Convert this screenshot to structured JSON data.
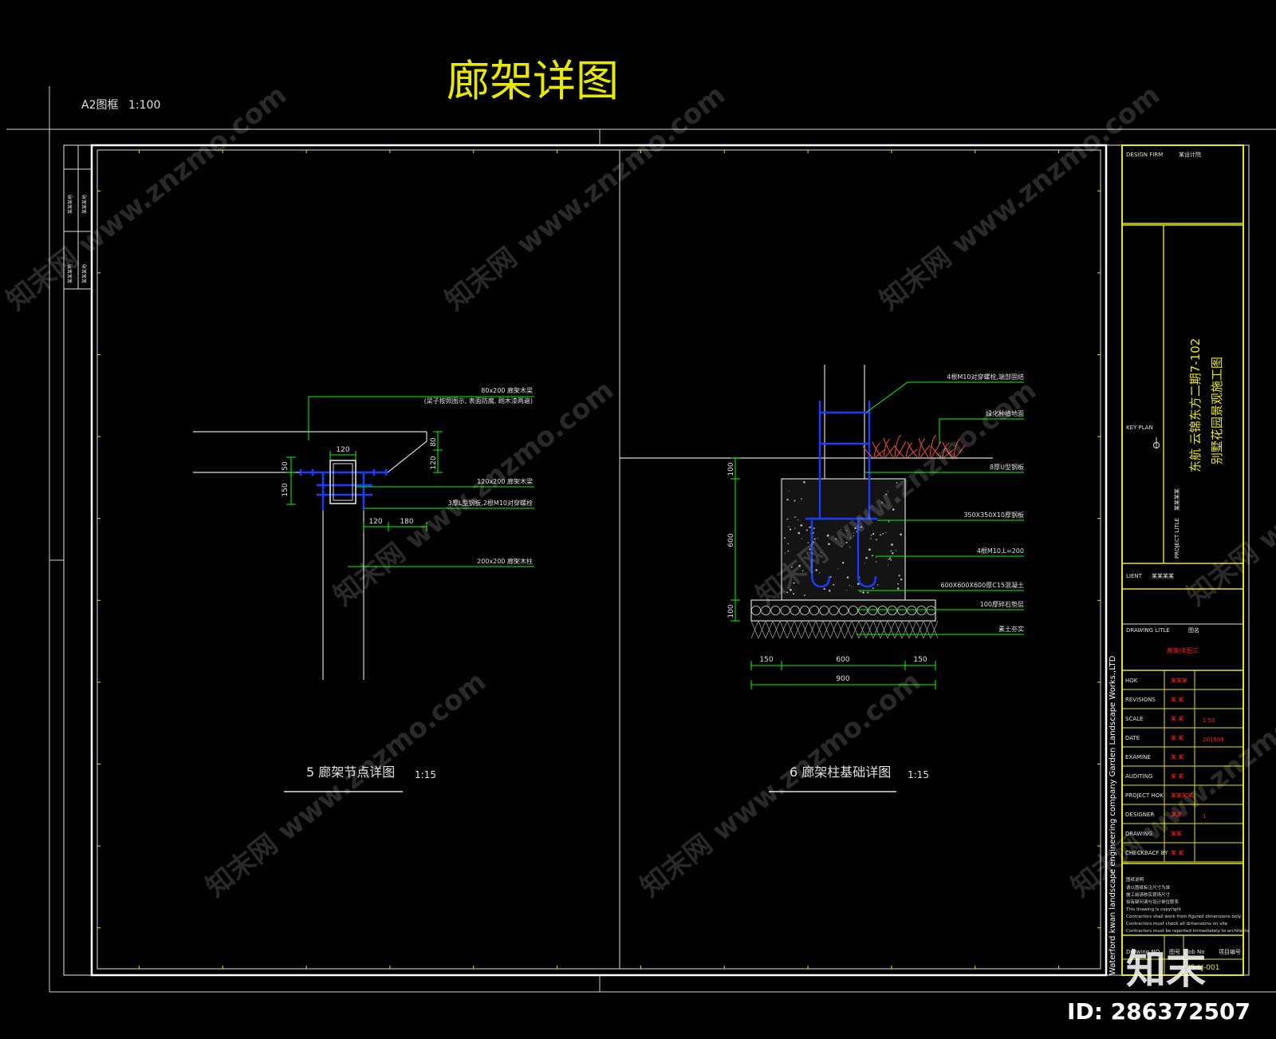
{
  "sheet": {
    "title": "廊架详图",
    "frame_label": "A2图框",
    "frame_scale": "1:100",
    "vertical_credit": "Waterford kwan landscape engineering company Garden Landscape Works.,LTD"
  },
  "left_margin_labels": [
    "某某某地",
    "某某某地",
    "某某某地",
    "某某某地"
  ],
  "detail5": {
    "title": "5 廊架节点详图",
    "scale": "1:15",
    "annotations": [
      "80x200 廊架木梁",
      "(梁子按照图示, 表面防腐, 刷木漆两遍)",
      "120x200 廊架木梁",
      "3厚L型钢板,2根M10对穿螺栓",
      "200x200 廊架木柱"
    ],
    "dims": [
      "120",
      "80",
      "120",
      "50",
      "150",
      "120",
      "180"
    ]
  },
  "detail6": {
    "title": "6 廊架柱基础详图",
    "scale": "1:15",
    "annotations": [
      "4根M10对穿螺栓,端部固结",
      "绿化种植地面",
      "8厚U型钢板",
      "350X350X10厚钢板",
      "4根M10,L=200",
      "600X600X600厚C15混凝土",
      "100厚碎石垫层",
      "素土夯实"
    ],
    "dims_v": [
      "100",
      "600",
      "100"
    ],
    "dims_h": [
      "150",
      "600",
      "150"
    ],
    "dims_total": "900"
  },
  "title_block": {
    "design_firm_label": "DESIGN FIRM",
    "design_firm_value": "某设计院",
    "key_plan_label": "KEY PLAN",
    "project_title_label": "PROJECT LITLE",
    "project_title_value": "某某某某",
    "project_name_1": "东航 云锦东方二期7-102",
    "project_name_2": "别墅花园景观施工图",
    "client_label": "LIENT",
    "client_value": "某某某某",
    "drawing_title_label": "DRAWING LITLE",
    "drawing_title_hdr": "图名",
    "drawing_title_value": "廊架详图三",
    "rows": [
      {
        "label": "HOK",
        "name": "某某某",
        "value": ""
      },
      {
        "label": "REVISIONS",
        "name": "某 某",
        "value": ""
      },
      {
        "label": "SCALE",
        "name": "某 某",
        "value": "1:50"
      },
      {
        "label": "DATE",
        "name": "某 某",
        "value": "201609"
      },
      {
        "label": "EXAMINE",
        "name": "某 某",
        "value": ""
      },
      {
        "label": "AUDITING",
        "name": "某 某",
        "value": ""
      },
      {
        "label": "PROJECT HOK",
        "name": "某某某某",
        "value": ""
      },
      {
        "label": "DESIGNER",
        "name": "某某",
        "value": "1"
      },
      {
        "label": "DRAWING",
        "name": "某某",
        "value": ""
      },
      {
        "label": "CHECKBACF BY",
        "name": "某 某",
        "value": ""
      }
    ],
    "notes_title": "图纸说明",
    "notes": [
      "请以图纸标注尺寸为准",
      "施工前请核实现场尺寸",
      "如有疑问请与设计单位联系",
      "This drawing is copyright",
      "Contractors shall work from figured dimensions only",
      "Contractors must check all dimensions on site",
      "Contractors must be reported immediately to architects"
    ],
    "drawing_no_label": "Drawing NO",
    "drawing_no_hdr": "图号",
    "job_no_label": "Job No",
    "job_no_hdr": "项目编号",
    "drawing_no_value": "JS-LJ-001"
  },
  "watermark": {
    "site": "知末网 www.znzmo.com",
    "logo": "知末",
    "id": "ID: 286372507"
  },
  "colors": {
    "background": "#000000",
    "frame": "#ffffff",
    "title": "#e8e800",
    "dim": "#00ff00",
    "steel": "#1a3cff",
    "grass": "#ff4a3a",
    "red_text": "#ff2020"
  }
}
